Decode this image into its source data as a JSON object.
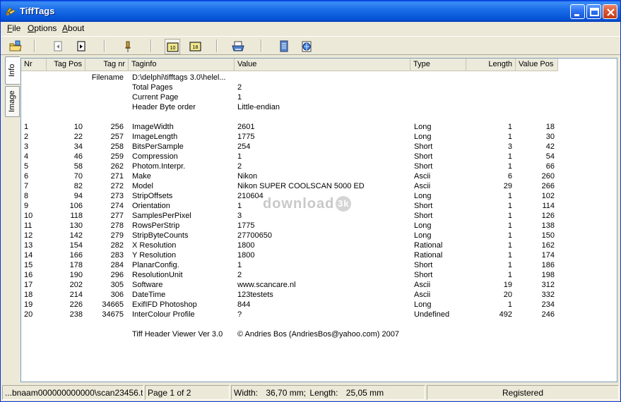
{
  "window": {
    "title": "TiffTags"
  },
  "menu": {
    "file": "F",
    "file_rest": "ile",
    "options": "O",
    "options_rest": "ptions",
    "about": "A",
    "about_rest": "bout"
  },
  "tabs": {
    "info": "Info",
    "image": "Image"
  },
  "columns": {
    "nr": "Nr",
    "tagpos": "Tag Pos",
    "tagnr": "Tag nr",
    "taginfo": "Taginfo",
    "value": "Value",
    "type": "Type",
    "length": "Length",
    "valuepos": "Value Pos"
  },
  "header_rows": [
    {
      "label": "Filename",
      "taginfo": "D:\\delphi\\tifftags 3.0\\helel...",
      "value": ""
    },
    {
      "label": "",
      "taginfo": "Total Pages",
      "value": "2"
    },
    {
      "label": "",
      "taginfo": "Current Page",
      "value": "1"
    },
    {
      "label": "",
      "taginfo": "Header Byte order",
      "value": "Little-endian"
    }
  ],
  "rows": [
    {
      "nr": "1",
      "pos": "10",
      "tag": "256",
      "info": "ImageWidth",
      "value": "2601",
      "type": "Long",
      "len": "1",
      "vpos": "18"
    },
    {
      "nr": "2",
      "pos": "22",
      "tag": "257",
      "info": "ImageLength",
      "value": "1775",
      "type": "Long",
      "len": "1",
      "vpos": "30"
    },
    {
      "nr": "3",
      "pos": "34",
      "tag": "258",
      "info": "BitsPerSample",
      "value": "254",
      "type": "Short",
      "len": "3",
      "vpos": "42"
    },
    {
      "nr": "4",
      "pos": "46",
      "tag": "259",
      "info": "Compression",
      "value": "1",
      "type": "Short",
      "len": "1",
      "vpos": "54"
    },
    {
      "nr": "5",
      "pos": "58",
      "tag": "262",
      "info": "Photom.Interpr.",
      "value": "2",
      "type": "Short",
      "len": "1",
      "vpos": "66"
    },
    {
      "nr": "6",
      "pos": "70",
      "tag": "271",
      "info": "Make",
      "value": "Nikon",
      "type": "Ascii",
      "len": "6",
      "vpos": "260"
    },
    {
      "nr": "7",
      "pos": "82",
      "tag": "272",
      "info": "Model",
      "value": "Nikon SUPER COOLSCAN 5000 ED",
      "type": "Ascii",
      "len": "29",
      "vpos": "266"
    },
    {
      "nr": "8",
      "pos": "94",
      "tag": "273",
      "info": "StripOffsets",
      "value": "210604",
      "type": "Long",
      "len": "1",
      "vpos": "102"
    },
    {
      "nr": "9",
      "pos": "106",
      "tag": "274",
      "info": "Orientation",
      "value": "1",
      "type": "Short",
      "len": "1",
      "vpos": "114"
    },
    {
      "nr": "10",
      "pos": "118",
      "tag": "277",
      "info": "SamplesPerPixel",
      "value": "3",
      "type": "Short",
      "len": "1",
      "vpos": "126"
    },
    {
      "nr": "11",
      "pos": "130",
      "tag": "278",
      "info": "RowsPerStrip",
      "value": "1775",
      "type": "Long",
      "len": "1",
      "vpos": "138"
    },
    {
      "nr": "12",
      "pos": "142",
      "tag": "279",
      "info": "StripByteCounts",
      "value": "27700650",
      "type": "Long",
      "len": "1",
      "vpos": "150"
    },
    {
      "nr": "13",
      "pos": "154",
      "tag": "282",
      "info": "X Resolution",
      "value": "1800",
      "type": "Rational",
      "len": "1",
      "vpos": "162"
    },
    {
      "nr": "14",
      "pos": "166",
      "tag": "283",
      "info": "Y Resolution",
      "value": "1800",
      "type": "Rational",
      "len": "1",
      "vpos": "174"
    },
    {
      "nr": "15",
      "pos": "178",
      "tag": "284",
      "info": "PlanarConfig.",
      "value": "1",
      "type": "Short",
      "len": "1",
      "vpos": "186"
    },
    {
      "nr": "16",
      "pos": "190",
      "tag": "296",
      "info": "ResolutionUnit",
      "value": "2",
      "type": "Short",
      "len": "1",
      "vpos": "198"
    },
    {
      "nr": "17",
      "pos": "202",
      "tag": "305",
      "info": "Software",
      "value": "www.scancare.nl",
      "type": "Ascii",
      "len": "19",
      "vpos": "312"
    },
    {
      "nr": "18",
      "pos": "214",
      "tag": "306",
      "info": "DateTime",
      "value": "123testets",
      "type": "Ascii",
      "len": "20",
      "vpos": "332"
    },
    {
      "nr": "19",
      "pos": "226",
      "tag": "34665",
      "info": "ExifIFD Photoshop",
      "value": "844",
      "type": "Long",
      "len": "1",
      "vpos": "234"
    },
    {
      "nr": "20",
      "pos": "238",
      "tag": "34675",
      "info": "InterColour Profile",
      "value": "?",
      "type": "Undefined",
      "len": "492",
      "vpos": "246"
    }
  ],
  "footer": {
    "viewer": "Tiff Header Viewer Ver 3.0",
    "copyright": "© Andries Bos (AndriesBos@yahoo.com) 2007"
  },
  "watermark": {
    "text": "download",
    "badge": "3k"
  },
  "status": {
    "file": "...bnaam000000000000\\scan23456.tif",
    "page": "Page 1 of 2",
    "width_label": "Width:",
    "width_value": "36,70 mm;",
    "length_label": "Length:",
    "length_value": "25,05 mm",
    "registered": "Registered"
  },
  "toolbar": {
    "page_left_label": "10",
    "page_right_label": "18"
  }
}
